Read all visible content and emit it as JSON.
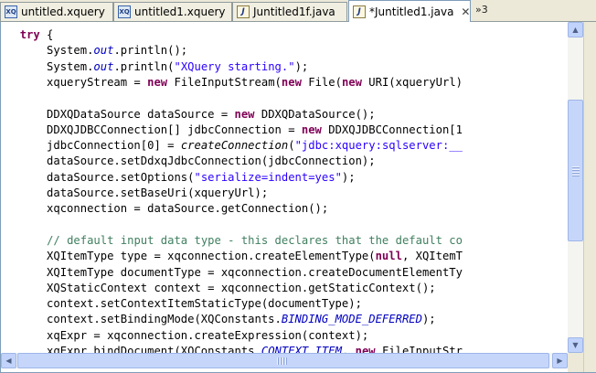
{
  "tabs": [
    {
      "label": "untitled.xquery",
      "icon": "xquery-file-icon"
    },
    {
      "label": "untitled1.xquery",
      "icon": "xquery-file-icon"
    },
    {
      "label": "Juntitled1f.java",
      "icon": "java-file-icon"
    },
    {
      "label": "*Juntitled1.java",
      "icon": "java-file-icon",
      "active": true,
      "close": "✕"
    }
  ],
  "overflow_label": "»3",
  "code_lines": [
    [
      {
        "t": "        "
      },
      {
        "t": "try",
        "c": "kw"
      },
      {
        "t": " {"
      }
    ],
    [
      {
        "t": "            System."
      },
      {
        "t": "out",
        "c": "stit"
      },
      {
        "t": ".println();"
      }
    ],
    [
      {
        "t": "            System."
      },
      {
        "t": "out",
        "c": "stit"
      },
      {
        "t": ".println("
      },
      {
        "t": "\"XQuery starting.\"",
        "c": "st"
      },
      {
        "t": ");"
      }
    ],
    [
      {
        "t": "            xqueryStream = "
      },
      {
        "t": "new",
        "c": "kw"
      },
      {
        "t": " FileInputStream("
      },
      {
        "t": "new",
        "c": "kw"
      },
      {
        "t": " File("
      },
      {
        "t": "new",
        "c": "kw"
      },
      {
        "t": " URI(xqueryUrl)"
      }
    ],
    [
      {
        "t": ""
      }
    ],
    [
      {
        "t": "            DDXQDataSource dataSource = "
      },
      {
        "t": "new",
        "c": "kw"
      },
      {
        "t": " DDXQDataSource();"
      }
    ],
    [
      {
        "t": "            DDXQJDBCConnection[] jdbcConnection = "
      },
      {
        "t": "new",
        "c": "kw"
      },
      {
        "t": " DDXQJDBCConnection[1"
      }
    ],
    [
      {
        "t": "            jdbcConnection[0] = "
      },
      {
        "t": "createConnection",
        "c": "it"
      },
      {
        "t": "("
      },
      {
        "t": "\"jdbc:xquery:sqlserver:__",
        "c": "st"
      }
    ],
    [
      {
        "t": "            dataSource.setDdxqJdbcConnection(jdbcConnection);"
      }
    ],
    [
      {
        "t": "            dataSource.setOptions("
      },
      {
        "t": "\"serialize=indent=yes\"",
        "c": "st"
      },
      {
        "t": ");"
      }
    ],
    [
      {
        "t": "            dataSource.setBaseUri(xqueryUrl);"
      }
    ],
    [
      {
        "t": "            xqconnection = dataSource.getConnection();"
      }
    ],
    [
      {
        "t": ""
      }
    ],
    [
      {
        "t": "            "
      },
      {
        "t": "// default input data type - this declares that the default co",
        "c": "cm"
      }
    ],
    [
      {
        "t": "            XQItemType type = xqconnection.createElementType("
      },
      {
        "t": "null",
        "c": "kw"
      },
      {
        "t": ", XQItemT"
      }
    ],
    [
      {
        "t": "            XQItemType documentType = xqconnection.createDocumentElementTy"
      }
    ],
    [
      {
        "t": "            XQStaticContext context = xqconnection.getStaticContext();"
      }
    ],
    [
      {
        "t": "            context.setContextItemStaticType(documentType);"
      }
    ],
    [
      {
        "t": "            context.setBindingMode(XQConstants."
      },
      {
        "t": "BINDING_MODE_DEFERRED",
        "c": "stit"
      },
      {
        "t": ");"
      }
    ],
    [
      {
        "t": "            xqExpr = xqconnection.createExpression(context);"
      }
    ],
    [
      {
        "t": "            xqExpr.bindDocument(XQConstants."
      },
      {
        "t": "CONTEXT_ITEM",
        "c": "stit"
      },
      {
        "t": ", "
      },
      {
        "t": "new",
        "c": "kw"
      },
      {
        "t": " FileInputStr"
      }
    ]
  ],
  "scroll": {
    "vertical_position": 0.36,
    "horizontal_position": 0.0
  },
  "colors": {
    "keyword": "#7f0055",
    "string": "#2a00ff",
    "comment": "#3f7f5f",
    "static_field": "#0000c0"
  }
}
